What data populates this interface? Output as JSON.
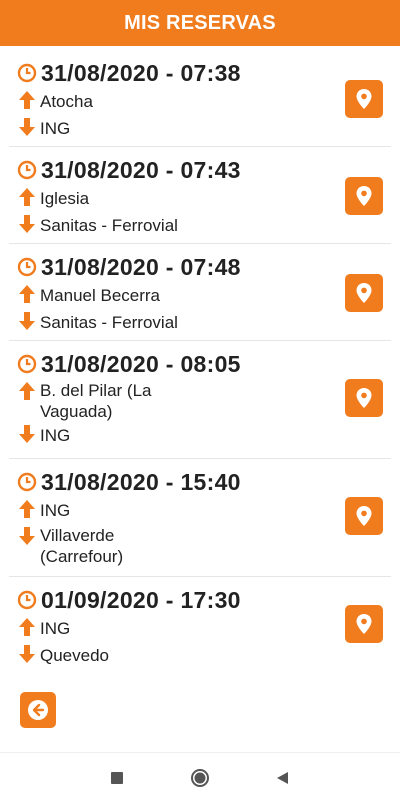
{
  "header": {
    "title": "MIS RESERVAS"
  },
  "colors": {
    "accent": "#f07c1e",
    "text": "#222222",
    "divider": "#e6e6e6"
  },
  "reservations": [
    {
      "datetime": "31/08/2020 - 07:38",
      "from": "Atocha",
      "to": "ING"
    },
    {
      "datetime": "31/08/2020 - 07:43",
      "from": "Iglesia",
      "to": "Sanitas - Ferrovial"
    },
    {
      "datetime": "31/08/2020 - 07:48",
      "from": "Manuel Becerra",
      "to": "Sanitas - Ferrovial"
    },
    {
      "datetime": "31/08/2020 - 08:05",
      "from": "B. del Pilar (La Vaguada)",
      "to": "ING"
    },
    {
      "datetime": "31/08/2020 - 15:40",
      "from": "ING",
      "to": "Villaverde (Carrefour)"
    },
    {
      "datetime": "01/09/2020 - 17:30",
      "from": "ING",
      "to": "Quevedo"
    }
  ],
  "icons": {
    "clock": "clock-icon",
    "up": "arrow-up-icon",
    "down": "arrow-down-icon",
    "pin": "map-pin-icon",
    "back": "arrow-left-circle-icon",
    "nav_recents": "square-icon",
    "nav_home": "circle-icon",
    "nav_back": "triangle-icon"
  }
}
